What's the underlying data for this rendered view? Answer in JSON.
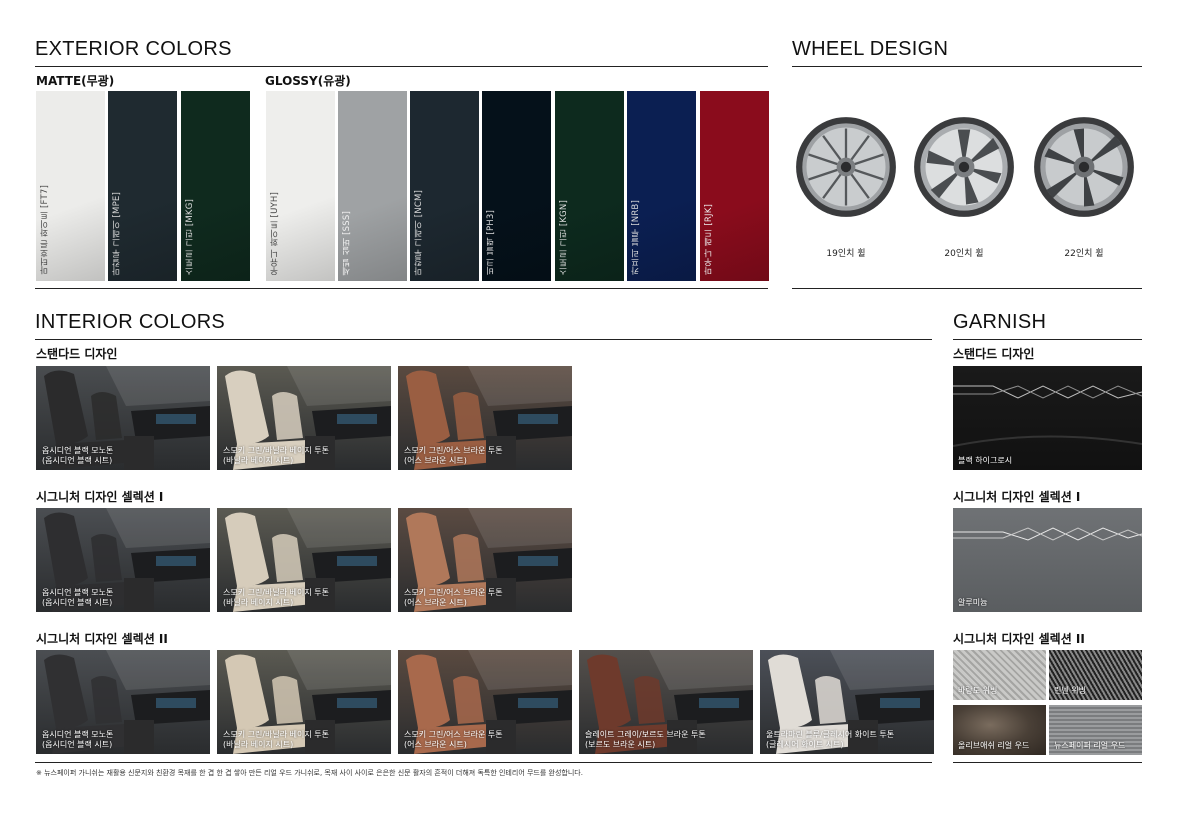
{
  "exterior": {
    "title": "EXTERIOR COLORS",
    "matte_label": "MATTE(무광)",
    "glossy_label": "GLOSSY(유광)",
    "matte": [
      {
        "name": "마터호른 화이트 [FT7]",
        "color": "#ececea",
        "text_color": "#444444"
      },
      {
        "name": "마칼루 그레이 [MPE]",
        "color": "#1f2a30",
        "text_color": "#dddddd"
      },
      {
        "name": "스토르 그린 [MKG]",
        "color": "#0f2a1e",
        "text_color": "#dddddd"
      }
    ],
    "glossy": [
      {
        "name": "우유니 화이트 [UYH]",
        "color": "#eeeeec",
        "text_color": "#444444"
      },
      {
        "name": "세빌 실버 [SSS]",
        "color": "#9fa2a4",
        "text_color": "#f2f2f2"
      },
      {
        "name": "마칼루 그레이 [NCM]",
        "color": "#1d2830",
        "text_color": "#dddddd"
      },
      {
        "name": "비크 블랙 [PH3]",
        "color": "#05111a",
        "text_color": "#dddddd"
      },
      {
        "name": "스토르 그린 [KGN]",
        "color": "#0d2a1e",
        "text_color": "#dddddd"
      },
      {
        "name": "카프리 블루 [NRB]",
        "color": "#0b1f52",
        "text_color": "#dddddd"
      },
      {
        "name": "마우나 레드 [RJK]",
        "color": "#8a0c1c",
        "text_color": "#eeeeee"
      }
    ]
  },
  "wheels": {
    "title": "WHEEL DESIGN",
    "items": [
      {
        "label": "19인치 휠"
      },
      {
        "label": "20인치 휠"
      },
      {
        "label": "22인치 휠"
      }
    ]
  },
  "interior": {
    "title": "INTERIOR COLORS",
    "groups": [
      {
        "label": "스탠다드 디자인",
        "items": [
          {
            "line1": "옵시디언 블랙 모노톤",
            "line2": "(옵시디언 블랙 시트)",
            "seat": "#2b2b2c",
            "bg": "#4a4d50"
          },
          {
            "line1": "스모키 그린/바닐라 베이지 투톤",
            "line2": "(바닐라 베이지 시트)",
            "seat": "#d8cfbf",
            "bg": "#5b5a52"
          },
          {
            "line1": "스모키 그린/어스 브라운 투톤",
            "line2": "(어스 브라운 시트)",
            "seat": "#9a5e42",
            "bg": "#5a4a40"
          }
        ]
      },
      {
        "label": "시그니처 디자인 셀렉션 I",
        "items": [
          {
            "line1": "옵시디언 블랙 모노톤",
            "line2": "(옵시디언 블랙 시트)",
            "seat": "#2e2e30",
            "bg": "#4b4e52"
          },
          {
            "line1": "스모키 그린/바닐라 베이지 투톤",
            "line2": "(바닐라 베이지 시트)",
            "seat": "#d6ccbb",
            "bg": "#5b5a52"
          },
          {
            "line1": "스모키 그린/어스 브라운 투톤",
            "line2": "(어스 브라운 시트)",
            "seat": "#b0785a",
            "bg": "#5b4b42"
          }
        ]
      },
      {
        "label": "시그니처 디자인 셀렉션 II",
        "items": [
          {
            "line1": "옵시디언 블랙 모노톤",
            "line2": "(옵시디언 블랙 시트)",
            "seat": "#303032",
            "bg": "#4b4e52"
          },
          {
            "line1": "스모키 그린/바닐라 베이지 투톤",
            "line2": "(바닐라 베이지 시트)",
            "seat": "#d4c8b4",
            "bg": "#5b5a52"
          },
          {
            "line1": "스모키 그린/어스 브라운 투톤",
            "line2": "(어스 브라운 시트)",
            "seat": "#a8694c",
            "bg": "#5a4a40"
          },
          {
            "line1": "슬레이트 그레이/보르도 브라운 투톤",
            "line2": "(보르도 브라운 시트)",
            "seat": "#6e3a2c",
            "bg": "#55504c"
          },
          {
            "line1": "울트라마린 블루/글레시어 화이트 투톤",
            "line2": "(글레시어 화이트 시트)",
            "seat": "#e0dcd6",
            "bg": "#4c5058"
          }
        ]
      }
    ]
  },
  "garnish": {
    "title": "GARNISH",
    "standard": {
      "label": "스탠다드 디자인",
      "item": "블랙 하이그로시",
      "color": "#111111"
    },
    "sel1": {
      "label": "시그니처 디자인 셀렉션 I",
      "item": "알루미늄",
      "color": "#6f7275"
    },
    "sel2": {
      "label": "시그니처 디자인 셀렉션 II",
      "items": [
        {
          "name": "바랑도 위빙",
          "color": "#b8b8b6"
        },
        {
          "name": "린넨 위빙",
          "color": "#444444"
        },
        {
          "name": "올리브애쉬 리얼 우드",
          "color": "#5a4f45"
        },
        {
          "name": "뉴스페이퍼 리얼 우드",
          "color": "#8a8c8e"
        }
      ]
    }
  },
  "footnote": "※ 뉴스페이퍼 가니쉬는 재활용 신문지와 친환경 목재를 한 겹 한 겹 쌓아 만든 리얼 우드 가니쉬로, 목재 사이 사이로 은은한 신문 활자의 흔적이 더해져 독특한 인테리어 무드를 완성합니다."
}
